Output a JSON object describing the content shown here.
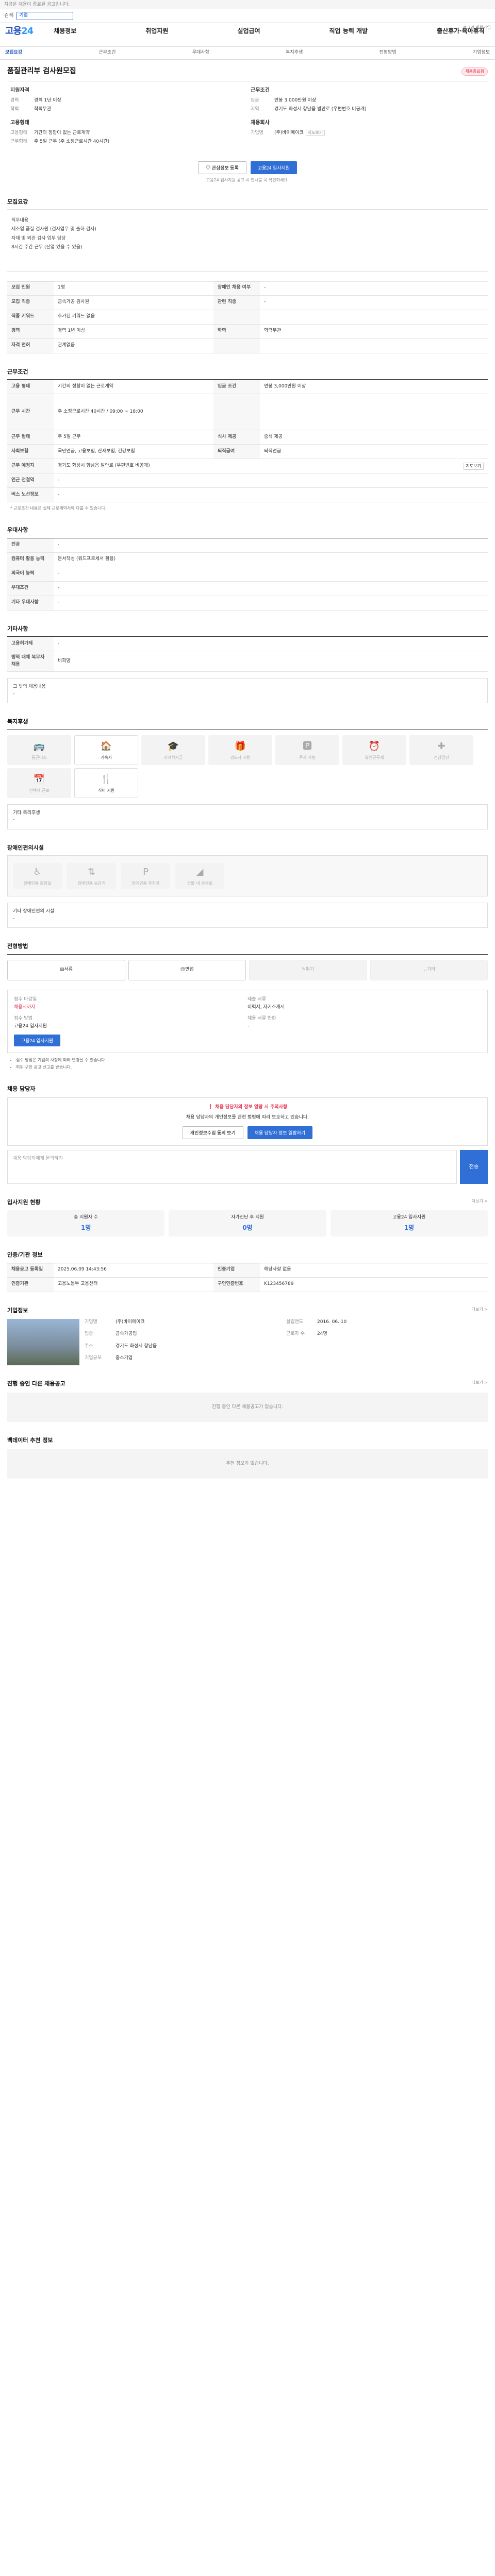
{
  "top": {
    "notice": "지금은 채용이 종료된 공고입니다."
  },
  "search": {
    "label": "검색",
    "field": "기업"
  },
  "logo": {
    "main": "고용",
    "accent": "24"
  },
  "nav": [
    "채용정보",
    "취업지원",
    "실업급여",
    "직업 능력 개발",
    "출산휴가·육아휴직"
  ],
  "header_right": "로그인 회원가입",
  "subnav": [
    "모집요강",
    "근무조건",
    "우대사항",
    "복지후생",
    "전형방법",
    "기업정보"
  ],
  "job": {
    "title": "품질관리부 검사원모집",
    "badge": "채용종료됨"
  },
  "summary": {
    "left_title": "지원자격",
    "left": [
      {
        "k": "경력",
        "v": "경력 1년 이상"
      },
      {
        "k": "학력",
        "v": "학력무관"
      }
    ],
    "left2_title": "고용형태",
    "left2": [
      {
        "k": "고용형태",
        "v": "기간의 정함이 없는 근로계약"
      },
      {
        "k": "근무형태",
        "v": "주 5일 근무 (주 소정근로시간 40시간)"
      }
    ],
    "right_title": "근무조건",
    "right": [
      {
        "k": "임금",
        "v": "연봉 3,000만원 이상"
      },
      {
        "k": "지역",
        "v": "경기도 화성시 향남읍 발안로 (우편번호 비공개)"
      }
    ],
    "right2_title": "채용회사",
    "right2": [
      {
        "k": "기업명",
        "v": "(주)바이메이크"
      }
    ],
    "map_link": "지도보기"
  },
  "buttons": {
    "scrap": "관심정보 등록",
    "apply": "고용24 입사지원"
  },
  "notice_text": "고용24 입사지원 공고 시 안내를 꼭 확인하세요.",
  "sections": {
    "recruit": "모집요강",
    "conditions": "근무조건",
    "preference": "우대사항",
    "welfare": "복지후생",
    "disability": "장애인편의시설",
    "screening": "전형방법",
    "contact": "채용 담당자",
    "stats": "입사지원 현황",
    "info": "인증/기관 정보",
    "company": "기업정보",
    "other_jobs": "진행 중인 다른 채용공고",
    "recommend": "백데이터 추천 정보"
  },
  "recruit_content": [
    "직무내용",
    "제조업 품질 검사원 (검사업무 및 출하 검사)",
    "자재 및 외관 검사 업무 담당",
    "8시간 주간 근무 (잔업 있을 수 있음)"
  ],
  "recruit_table": [
    {
      "h1": "모집 인원",
      "v1": "1명",
      "h2": "장애인 채용 여부",
      "v2": "-"
    },
    {
      "h1": "모집 직종",
      "v1": "금속가공 검사원",
      "h2": "관련 직종",
      "v2": "-"
    },
    {
      "h1": "직종 키워드",
      "v1": "추가된 키워드 없음",
      "h2": "",
      "v2": ""
    },
    {
      "h1": "경력",
      "v1": "경력 1년 이상",
      "h2": "학력",
      "v2": "학력무관"
    },
    {
      "h1": "자격 면허",
      "v1": "관계없음",
      "h2": "",
      "v2": ""
    }
  ],
  "cond_table": [
    {
      "h": "고용 형태",
      "v": "기간의 정함이 없는 근로계약",
      "h2": "임금 조건",
      "v2": "연봉 3,000만원 이상"
    },
    {
      "h": "근무 시간",
      "v": "주 소정근로시간 40시간 / 09:00 ~ 18:00",
      "h2": "",
      "v2": ""
    },
    {
      "h": "근무 형태",
      "v": "주 5일 근무",
      "h2": "식사 제공",
      "v2": "중식 제공"
    },
    {
      "h": "사회보험",
      "v": "국민연금, 고용보험, 산재보험, 건강보험",
      "h2": "퇴직급여",
      "v2": "퇴직연금"
    },
    {
      "h": "근무 예정지",
      "v": "경기도 화성시 향남읍 발안로 (우편번호 비공개)",
      "h2": "",
      "v2": ""
    },
    {
      "h": "인근 전철역",
      "v": "-",
      "h2": "",
      "v2": ""
    },
    {
      "h": "버스 노선정보",
      "v": "-",
      "h2": "",
      "v2": ""
    }
  ],
  "cond_footnote": "* 근로조건 내용은 실제 근로계약서와 다를 수 있습니다.",
  "pref_table": [
    {
      "h": "전공",
      "v": "-"
    },
    {
      "h": "컴퓨터 활용 능력",
      "v": "문서작성 (워드프로세서 활용)"
    },
    {
      "h": "외국어 능력",
      "v": "-"
    },
    {
      "h": "우대조건",
      "v": "-"
    },
    {
      "h": "기타 우대사항",
      "v": "-"
    }
  ],
  "pref2_title": "기타사항",
  "pref2_table": [
    {
      "h": "고용허가제",
      "v": "-"
    },
    {
      "h": "병역 대체 복무자 채용",
      "v": "비희망"
    }
  ],
  "pref2_empty": "그 밖의 채용내용",
  "welfare_cards": [
    {
      "name": "통근버스",
      "icon": "bus-icon",
      "glyph": "🚌",
      "on": false
    },
    {
      "name": "기숙사",
      "icon": "dorm-icon",
      "glyph": "🏠",
      "on": true
    },
    {
      "name": "자녀학자금",
      "icon": "school-icon",
      "glyph": "🎓",
      "on": false
    },
    {
      "name": "경조사 지원",
      "icon": "gift-icon",
      "glyph": "🎁",
      "on": false
    },
    {
      "name": "주차 가능",
      "icon": "parking-icon",
      "glyph": "🅿",
      "on": false
    },
    {
      "name": "유연근무제",
      "icon": "clock-icon",
      "glyph": "⏰",
      "on": false
    },
    {
      "name": "건강검진",
      "icon": "health-icon",
      "glyph": "✚",
      "on": false
    },
    {
      "name": "선택적 근로",
      "icon": "calendar-icon",
      "glyph": "📅",
      "on": false
    },
    {
      "name": "식비 지원",
      "icon": "meal-icon",
      "glyph": "🍴",
      "on": true
    }
  ],
  "welfare_other_title": "기타 복리후생",
  "disability_cards": [
    "장애인용 화장실",
    "장애인용 승강기",
    "장애인용 주차장",
    "건물 내 경사로"
  ],
  "disability_other_title": "기타 장애인편의 시설",
  "screen_cards": [
    {
      "label": "서류",
      "on": true
    },
    {
      "label": "면접",
      "on": true
    },
    {
      "label": "필기",
      "on": false
    },
    {
      "label": "기타",
      "on": false
    }
  ],
  "apply": {
    "col1": [
      {
        "k": "접수 마감일",
        "v": "채용시까지"
      },
      {
        "k": "접수 방법",
        "v": "고용24 입사지원"
      }
    ],
    "col2": [
      {
        "k": "제출 서류",
        "v": "이력서, 자기소개서"
      },
      {
        "k": "채용 서류 반환",
        "v": "-"
      }
    ],
    "apply_btn": "고용24 입사지원"
  },
  "apply_notes": [
    "접수 방법은 기업의 사정에 따라 변경될 수 있습니다.",
    "허위 구인 광고 신고를 받습니다."
  ],
  "contact": {
    "red": "채용 담당자의 정보 열람 시 주의사항",
    "desc": "채용 담당자의 개인정보를 관련 법령에 따라 보호하고 있습니다.",
    "btn1": "개인정보수집 동의 보기",
    "btn2": "채용 담당자 정보 열람하기"
  },
  "inquiry": {
    "placeholder": "채용 담당자에게 문의하기",
    "submit": "전송"
  },
  "stats": [
    {
      "label": "총 지원자 수",
      "num": "1명"
    },
    {
      "label": "자가진단 후 지원",
      "num": "0명"
    },
    {
      "label": "고용24 입사지원",
      "num": "1명"
    }
  ],
  "info_table": [
    {
      "h": "채용공고 등록일",
      "v": "2025.06.09 14:43:56",
      "h2": "인증기업",
      "v2": "해당사항 없음"
    },
    {
      "h": "인증기관",
      "v": "고용노동부 고용센터",
      "h2": "구인인증번호",
      "v2": "K123456789"
    }
  ],
  "company": {
    "rows": [
      {
        "k": "기업명",
        "v": "(주)바이메이크",
        "k2": "설립연도",
        "v2": "2016. 06. 10"
      },
      {
        "k": "업종",
        "v": "금속가공업",
        "k2": "근로자 수",
        "v2": "24명"
      },
      {
        "k": "주소",
        "v": "경기도 화성시 향남읍",
        "k2": "",
        "v2": ""
      },
      {
        "k": "기업규모",
        "v": "중소기업",
        "k2": "",
        "v2": ""
      }
    ]
  },
  "other_jobs_empty": "진행 중인 다른 채용공고가 없습니다.",
  "recommend_empty": "추천 정보가 없습니다.",
  "more": "더보기 >",
  "colors": {
    "brand": "#1d4fb8",
    "accent": "#2f6fd6",
    "alert": "#e53550"
  }
}
